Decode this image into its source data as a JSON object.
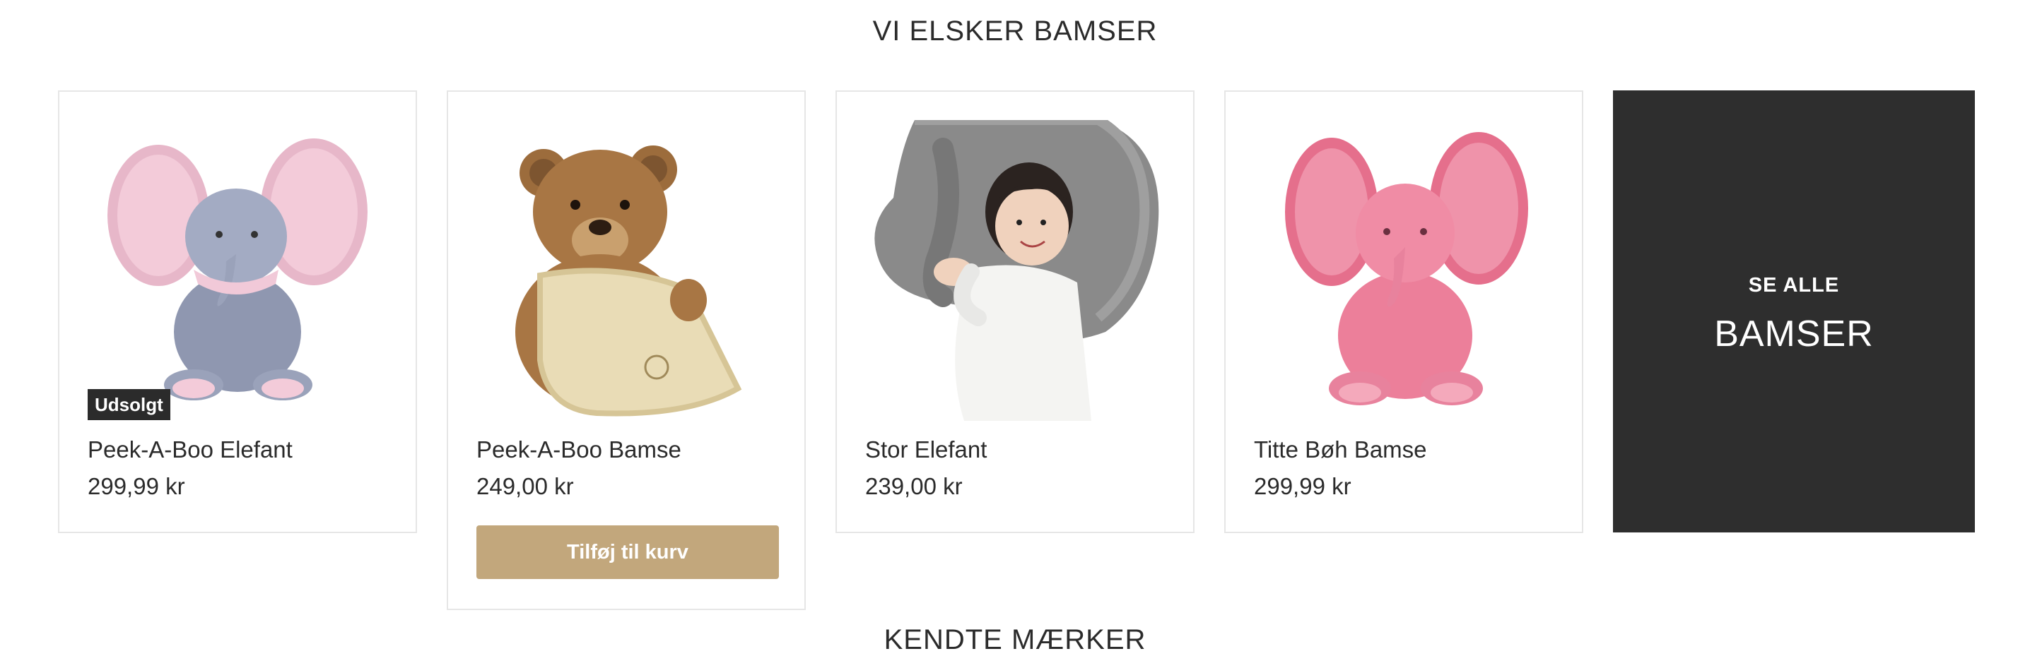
{
  "section": {
    "title": "VI ELSKER BAMSER"
  },
  "products": [
    {
      "name": "Peek-A-Boo Elefant",
      "price": "299,99 kr",
      "badge": "Udsolgt",
      "image": "grey-pink-elephant-plush"
    },
    {
      "name": "Peek-A-Boo Bamse",
      "price": "249,00 kr",
      "button": "Tilføj til kurv",
      "image": "brown-teddy-bear-with-blanket"
    },
    {
      "name": "Stor Elefant",
      "price": "239,00 kr",
      "image": "large-grey-elephant-with-baby"
    },
    {
      "name": "Titte Bøh Bamse",
      "price": "299,99 kr",
      "image": "pink-elephant-plush"
    }
  ],
  "see_all": {
    "small": "SE ALLE",
    "big": "BAMSER"
  },
  "next_section": {
    "title": "KENDTE MÆRKER"
  },
  "colors": {
    "button": "#c2a77c",
    "see_all_bg": "#2e2e2e",
    "badge_bg": "#2b2b2b",
    "text": "#2b2b2b"
  }
}
